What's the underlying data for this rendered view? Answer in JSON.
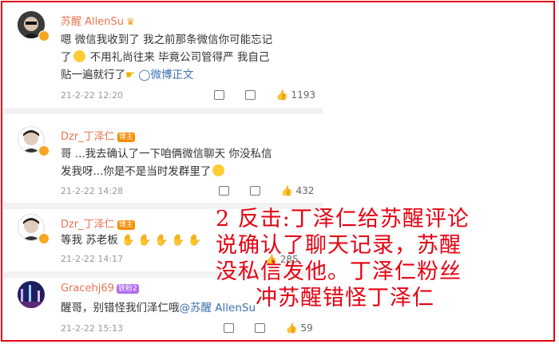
{
  "comments": [
    {
      "username": "苏醒 AllenSu",
      "badge": "",
      "lines": [
        "嗯 微信我收到了 我之前那条微信你可能忘记",
        "了",
        "不用礼尚往来 毕竟公司管得严 我自己",
        "贴一遍就行了"
      ],
      "link": "◯微博正文",
      "time": "21-2-22 12:20",
      "likes": "1193"
    },
    {
      "username": "Dzr_丁泽仁",
      "badge": "博主",
      "lines": [
        "哥 ...我去确认了一下咱俩微信聊天 你没私信",
        "发我呀...你是不是当时发群里了"
      ],
      "time": "21-2-22 14:28",
      "likes": "432"
    },
    {
      "username": "Dzr_丁泽仁",
      "badge": "博主",
      "lines": [
        "等我 苏老板"
      ],
      "time": "21-2-22 14:17",
      "likes": "285"
    },
    {
      "username": "Gracehj69",
      "badge": "铁粉2",
      "lines": [
        "醒哥，别错怪我们泽仁哦"
      ],
      "mention": "@苏醒 AllenSu",
      "time": "21-2-22 15:13",
      "likes": "59"
    }
  ],
  "overlay": {
    "lines": [
      "2 反击:丁泽仁给苏醒评论",
      "说确认了聊天记录，苏醒",
      "没私信发他。丁泽仁粉丝",
      "冲苏醒错怪丁泽仁"
    ]
  },
  "colors": {
    "accent": "#e60012",
    "username": "#eb7350",
    "link": "#3b6fb0"
  }
}
